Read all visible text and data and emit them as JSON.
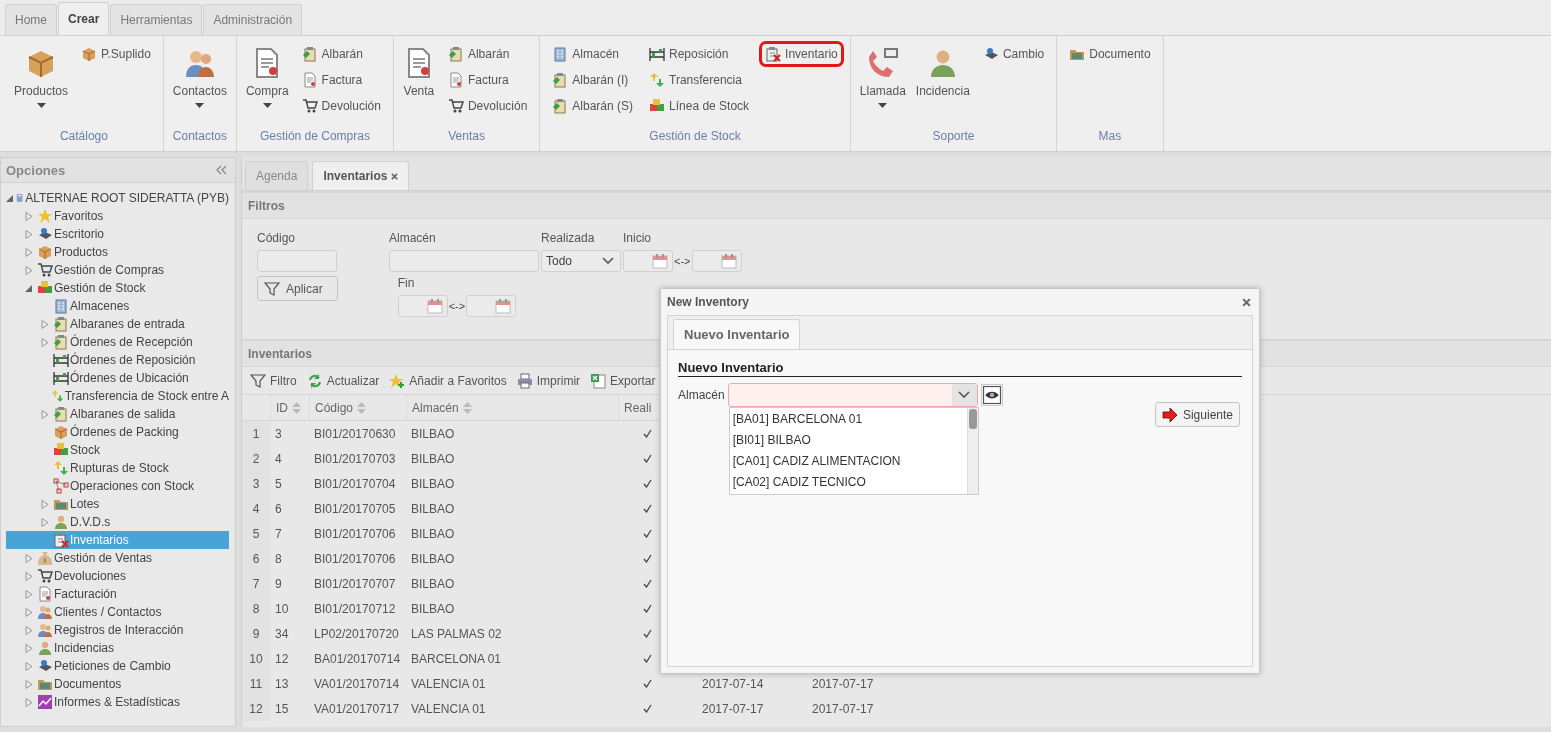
{
  "ribbon_tabs": [
    {
      "label": "Home",
      "selected": false
    },
    {
      "label": "Crear",
      "selected": true
    },
    {
      "label": "Herramientas",
      "selected": false
    },
    {
      "label": "Administración",
      "selected": false
    }
  ],
  "ribbon_groups": [
    {
      "label": "Catálogo",
      "columns": [
        {
          "kind": "large",
          "label": "Productos",
          "dropdown": true
        },
        {
          "kind": "small",
          "items": [
            {
              "label": "P.Suplido",
              "highlighted": false
            }
          ]
        }
      ]
    },
    {
      "label": "Contactos",
      "columns": [
        {
          "kind": "large",
          "label": "Contactos",
          "dropdown": true
        }
      ]
    },
    {
      "label": "Gestión de Compras",
      "columns": [
        {
          "kind": "large",
          "label": "Compra",
          "dropdown": true
        },
        {
          "kind": "small",
          "items": [
            {
              "label": "Albarán",
              "highlighted": false
            },
            {
              "label": "Factura",
              "highlighted": false
            },
            {
              "label": "Devolución",
              "highlighted": false
            }
          ]
        }
      ]
    },
    {
      "label": "Ventas",
      "columns": [
        {
          "kind": "large",
          "label": "Venta",
          "dropdown": false
        },
        {
          "kind": "small",
          "items": [
            {
              "label": "Albarán",
              "highlighted": false
            },
            {
              "label": "Factura",
              "highlighted": false
            },
            {
              "label": "Devolución",
              "highlighted": false
            }
          ]
        }
      ]
    },
    {
      "label": "Gestión de Stock",
      "columns": [
        {
          "kind": "small",
          "items": [
            {
              "label": "Almacén",
              "highlighted": false
            },
            {
              "label": "Albarán (I)",
              "highlighted": false
            },
            {
              "label": "Albarán (S)",
              "highlighted": false
            }
          ]
        },
        {
          "kind": "small",
          "items": [
            {
              "label": "Reposición",
              "highlighted": false
            },
            {
              "label": "Transferencia",
              "highlighted": false
            },
            {
              "label": "Línea de Stock",
              "highlighted": false
            }
          ]
        },
        {
          "kind": "small",
          "items": [
            {
              "label": "Inventario",
              "highlighted": true
            }
          ]
        }
      ]
    },
    {
      "label": "Soporte",
      "columns": [
        {
          "kind": "large",
          "label": "Llamada",
          "dropdown": true
        },
        {
          "kind": "large",
          "label": "Incidencia",
          "dropdown": false
        },
        {
          "kind": "small",
          "items": [
            {
              "label": "Cambio",
              "highlighted": false
            }
          ]
        }
      ]
    },
    {
      "label": "Mas",
      "columns": [
        {
          "kind": "small",
          "items": [
            {
              "label": "Documento",
              "highlighted": false
            }
          ]
        }
      ]
    }
  ],
  "sidebar": {
    "title": "Opciones",
    "tree": [
      {
        "label": "ALTERNAE ROOT SIDERATTA (PYB)",
        "expanded": true,
        "selected": false,
        "children": [
          {
            "label": "Favoritos",
            "expanded": false,
            "selected": false
          },
          {
            "label": "Escritorio",
            "expanded": false,
            "selected": false
          },
          {
            "label": "Productos",
            "expanded": false,
            "selected": false
          },
          {
            "label": "Gestión de Compras",
            "expanded": false,
            "selected": false
          },
          {
            "label": "Gestión de Stock",
            "expanded": true,
            "selected": false,
            "children": [
              {
                "label": "Almacenes",
                "selected": false
              },
              {
                "label": "Albaranes de entrada",
                "expanded": false,
                "selected": false
              },
              {
                "label": "Órdenes de Recepción",
                "expanded": false,
                "selected": false
              },
              {
                "label": "Órdenes de Reposición",
                "selected": false
              },
              {
                "label": "Órdenes de Ubicación",
                "selected": false
              },
              {
                "label": "Transferencia de Stock entre A",
                "selected": false
              },
              {
                "label": "Albaranes de salida",
                "expanded": false,
                "selected": false
              },
              {
                "label": "Órdenes de Packing",
                "selected": false
              },
              {
                "label": "Stock",
                "selected": false
              },
              {
                "label": "Rupturas de Stock",
                "selected": false
              },
              {
                "label": "Operaciones con Stock",
                "selected": false
              },
              {
                "label": "Lotes",
                "expanded": false,
                "selected": false
              },
              {
                "label": "D.V.D.s",
                "expanded": false,
                "selected": false
              },
              {
                "label": "Inventarios",
                "selected": true
              }
            ]
          },
          {
            "label": "Gestión de Ventas",
            "expanded": false,
            "selected": false
          },
          {
            "label": "Devoluciones",
            "expanded": false,
            "selected": false
          },
          {
            "label": "Facturación",
            "expanded": false,
            "selected": false
          },
          {
            "label": "Clientes / Contactos",
            "expanded": false,
            "selected": false
          },
          {
            "label": "Registros de Interacción",
            "expanded": false,
            "selected": false
          },
          {
            "label": "Incidencias",
            "expanded": false,
            "selected": false
          },
          {
            "label": "Peticiones de Cambio",
            "expanded": false,
            "selected": false
          },
          {
            "label": "Documentos",
            "expanded": false,
            "selected": false
          },
          {
            "label": "Informes & Estadísticas",
            "expanded": false,
            "selected": false
          }
        ]
      }
    ]
  },
  "main_tabs": [
    {
      "label": "Agenda",
      "selected": false,
      "closable": false
    },
    {
      "label": "Inventarios",
      "selected": true,
      "closable": true
    }
  ],
  "filters": {
    "title": "Filtros",
    "fields": [
      {
        "kind": "text",
        "label": "Código"
      },
      {
        "kind": "text-wide",
        "label": "Almacén"
      },
      {
        "kind": "select",
        "label": "Realizada",
        "value": "Todo"
      },
      {
        "kind": "date-range",
        "label": "Inicio",
        "separator": "<->"
      },
      {
        "kind": "button",
        "label": "Aplicar"
      },
      {
        "kind": "date-range",
        "label": "Fin",
        "separator": "<->"
      }
    ]
  },
  "grid": {
    "title": "Inventarios",
    "toolbar": [
      "Filtro",
      "Actualizar",
      "Añadir a Favoritos",
      "Imprimir",
      "Exportar"
    ],
    "columns": [
      "ID",
      "Código",
      "Almacén",
      "Reali"
    ],
    "rows": [
      {
        "number": "1",
        "id": "3",
        "code": "BI01/20170630",
        "warehouse": "BILBAO",
        "done": true
      },
      {
        "number": "2",
        "id": "4",
        "code": "BI01/20170703",
        "warehouse": "BILBAO",
        "done": true
      },
      {
        "number": "3",
        "id": "5",
        "code": "BI01/20170704",
        "warehouse": "BILBAO",
        "done": true
      },
      {
        "number": "4",
        "id": "6",
        "code": "BI01/20170705",
        "warehouse": "BILBAO",
        "done": true
      },
      {
        "number": "5",
        "id": "7",
        "code": "BI01/20170706",
        "warehouse": "BILBAO",
        "done": true
      },
      {
        "number": "6",
        "id": "8",
        "code": "BI01/20170706",
        "warehouse": "BILBAO",
        "done": true
      },
      {
        "number": "7",
        "id": "9",
        "code": "BI01/20170707",
        "warehouse": "BILBAO",
        "done": true
      },
      {
        "number": "8",
        "id": "10",
        "code": "BI01/20170712",
        "warehouse": "BILBAO",
        "done": true
      },
      {
        "number": "9",
        "id": "34",
        "code": "LP02/20170720",
        "warehouse": "LAS PALMAS 02",
        "done": true
      },
      {
        "number": "10",
        "id": "12",
        "code": "BA01/20170714",
        "warehouse": "BARCELONA 01",
        "done": true
      },
      {
        "number": "11",
        "id": "13",
        "code": "VA01/20170714",
        "warehouse": "VALENCIA 01",
        "done": true,
        "column_6": "2017-07-14",
        "column_7": "2017-07-17"
      },
      {
        "number": "12",
        "id": "15",
        "code": "VA01/20170717",
        "warehouse": "VALENCIA 01",
        "done": true,
        "column_6": "2017-07-17",
        "column_7": "2017-07-17"
      }
    ]
  },
  "dialog": {
    "title": "New Inventory",
    "tabs": [
      {
        "label": "Nuevo Inventario",
        "selected": true
      }
    ],
    "section": "Nuevo Inventario",
    "field_label": "Almacén",
    "invalid": true,
    "dropdown_open": true,
    "options": [
      "[BA01] BARCELONA 01",
      "[BI01] BILBAO",
      "[CA01] CADIZ ALIMENTACION",
      "[CA02] CADIZ TECNICO"
    ],
    "button": "Siguiente"
  }
}
